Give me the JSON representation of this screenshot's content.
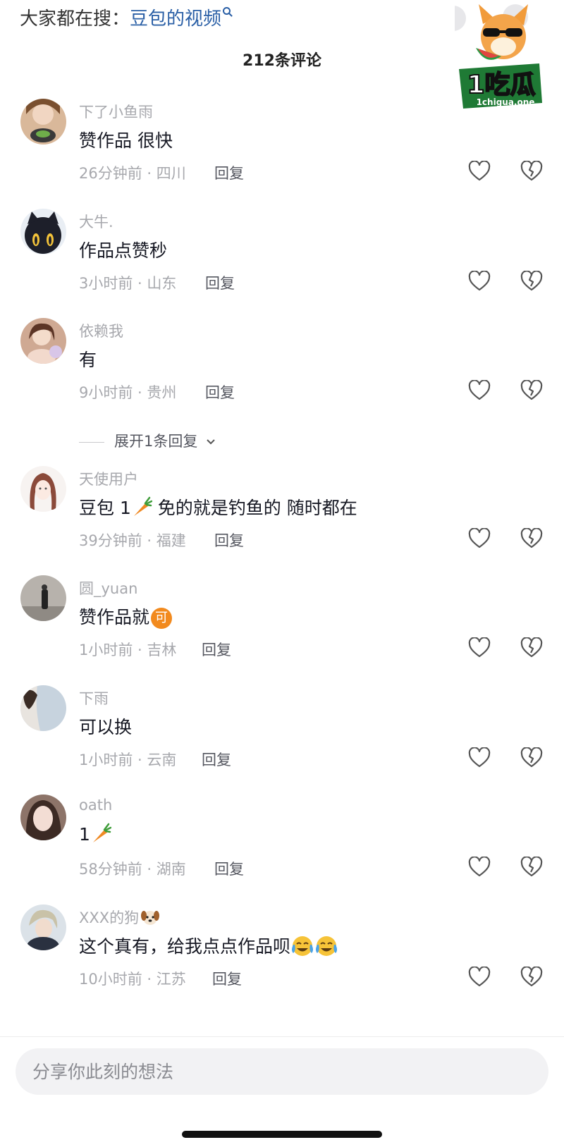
{
  "search_hint": {
    "prefix": "大家都在搜：",
    "keyword": "豆包的视频"
  },
  "logo": {
    "text": "1吃瓜",
    "url_text": "1chigua.one"
  },
  "comment_count": "212条评论",
  "reply_label": "回复",
  "expand_label": "展开1条回复",
  "comments": [
    {
      "username": "下了小鱼雨",
      "text": "赞作品 很快",
      "meta": "26分钟前 · 四川"
    },
    {
      "username": "大牛.",
      "text": "作品点赞秒",
      "meta": "3小时前 · 山东"
    },
    {
      "username": "依赖我",
      "text": "有",
      "meta": "9小时前 · 贵州"
    },
    {
      "username": "天使用户",
      "text_before": "豆包 1",
      "text_after": " 免的就是钓鱼的 随时都在",
      "meta": "39分钟前 · 福建"
    },
    {
      "username": "圆_yuan",
      "text": "赞作品就",
      "badge": "可",
      "meta": "1小时前 · 吉林"
    },
    {
      "username": "下雨",
      "text": "可以换",
      "meta": "1小时前 · 云南"
    },
    {
      "username": "oath",
      "text": "1",
      "meta": "58分钟前 · 湖南"
    },
    {
      "username": "XXX的狗",
      "text": "这个真有，给我点点作品呗",
      "meta": "10小时前 · 江苏"
    }
  ],
  "input": {
    "placeholder": "分享你此刻的想法"
  },
  "icons": {
    "like": "heart-icon",
    "dislike": "broken-heart-icon",
    "expand": "chevron-down-icon",
    "carrot": "carrot-emoji",
    "dog": "dog-emoji",
    "crying": "crying-laughing-emoji"
  },
  "colors": {
    "keyword_link": "#2a5fa6",
    "secondary_text": "#a7a8ad",
    "primary_text": "#161823"
  }
}
